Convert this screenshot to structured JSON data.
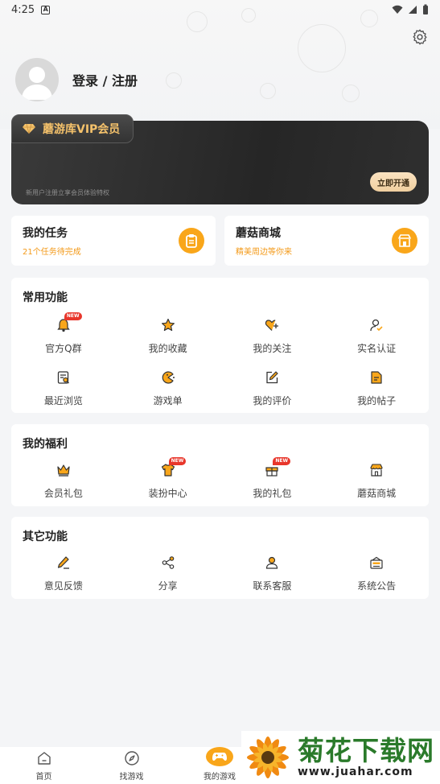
{
  "status_bar": {
    "time": "4:25",
    "notification": "A"
  },
  "profile": {
    "login_label": "登录 / 注册"
  },
  "vip": {
    "title": "蘑游库VIP会员",
    "subtitle": "新用户注册立享会员体验特权",
    "button": "立即开通"
  },
  "quick_cards": [
    {
      "title": "我的任务",
      "subtitle": "21个任务待完成",
      "icon": "clipboard-icon"
    },
    {
      "title": "蘑菇商城",
      "subtitle": "精美周边等你来",
      "icon": "store-icon"
    }
  ],
  "common": {
    "title": "常用功能",
    "items": [
      {
        "label": "官方Q群",
        "icon": "bell-icon",
        "badge": "NEW"
      },
      {
        "label": "我的收藏",
        "icon": "star-icon"
      },
      {
        "label": "我的关注",
        "icon": "heart-plus-icon"
      },
      {
        "label": "实名认证",
        "icon": "user-check-icon"
      },
      {
        "label": "最近浏览",
        "icon": "history-icon"
      },
      {
        "label": "游戏单",
        "icon": "pacman-icon"
      },
      {
        "label": "我的评价",
        "icon": "edit-icon"
      },
      {
        "label": "我的帖子",
        "icon": "document-icon"
      }
    ]
  },
  "welfare": {
    "title": "我的福利",
    "items": [
      {
        "label": "会员礼包",
        "icon": "crown-icon"
      },
      {
        "label": "装扮中心",
        "icon": "shirt-icon",
        "badge": "NEW"
      },
      {
        "label": "我的礼包",
        "icon": "gift-icon",
        "badge": "NEW"
      },
      {
        "label": "蘑菇商城",
        "icon": "shop-icon"
      }
    ]
  },
  "other": {
    "title": "其它功能",
    "items": [
      {
        "label": "意见反馈",
        "icon": "pen-icon"
      },
      {
        "label": "分享",
        "icon": "share-icon"
      },
      {
        "label": "联系客服",
        "icon": "person-icon"
      },
      {
        "label": "系统公告",
        "icon": "announcement-icon"
      }
    ]
  },
  "nav": [
    {
      "label": "首页",
      "icon": "home-icon"
    },
    {
      "label": "找游戏",
      "icon": "compass-icon"
    },
    {
      "label": "我的游戏",
      "icon": "gamepad-icon"
    }
  ],
  "watermark": {
    "title": "菊花下载网",
    "url": "www.juahar.com"
  },
  "colors": {
    "accent": "#f9a61a",
    "badge": "#e8362b",
    "vip_gold": "#f5c26b"
  }
}
